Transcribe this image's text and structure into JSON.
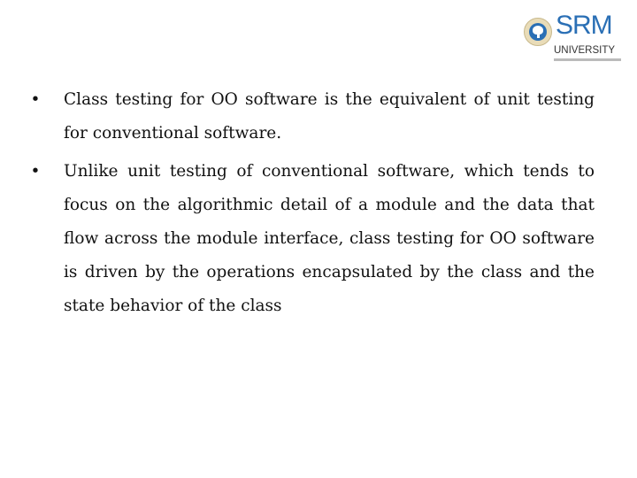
{
  "logo": {
    "brand": "SRM",
    "subtitle": "UNIVERSITY",
    "brand_color": "#2a6fb5"
  },
  "bullets": [
    {
      "marker": "•",
      "text": "Class testing for OO software is the equivalent of unit testing for conventional software."
    },
    {
      "marker": "•",
      "text": "Unlike unit testing of conventional software, which tends to focus on the algorithmic detail of a module and the data that flow across the module interface, class testing for OO software is driven by the operations encapsulated by the class and the state behavior of the class"
    }
  ]
}
